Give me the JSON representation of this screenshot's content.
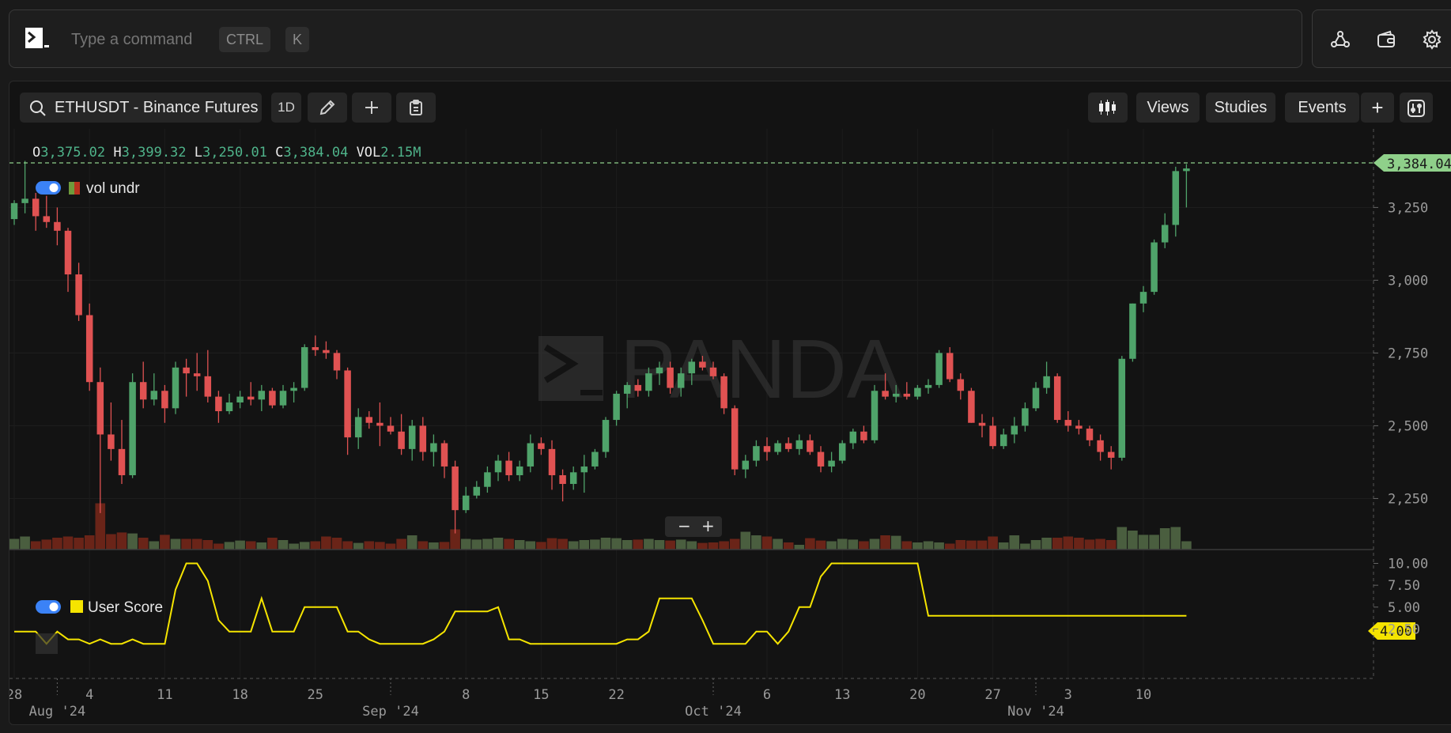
{
  "command_bar": {
    "placeholder": "Type a command",
    "key1": "CTRL",
    "key2": "K"
  },
  "toolbar": {
    "symbol": "ETHUSDT - Binance Futures",
    "interval": "1D",
    "views": "Views",
    "studies": "Studies",
    "events": "Events",
    "plus": "+"
  },
  "ohlc": {
    "o_label": "O",
    "o": "3,375.02",
    "h_label": "H",
    "h": "3,399.32",
    "l_label": "L",
    "l": "3,250.01",
    "c_label": "C",
    "c": "3,384.04",
    "vol_label": "VOL",
    "vol": "2.15M"
  },
  "legends": {
    "volume_study": "vol undr",
    "score_study": "User Score"
  },
  "watermark": "PANDA",
  "last_price_label": "3,384.04",
  "score_last_label": "4.00",
  "zoom": {
    "minus": "−",
    "plus": "+"
  },
  "colors": {
    "up": "#4fa36a",
    "down": "#e05252",
    "vol_up": "#4a5e3f",
    "vol_down": "#6a2418",
    "score": "#f5e400",
    "accent": "#3b82f6",
    "price_tag": "#8fd08a"
  },
  "chart_data": {
    "type": "candlestick",
    "price_axis": {
      "ticks": [
        "3,250",
        "3,000",
        "2,750",
        "2,500",
        "2,250"
      ],
      "range": [
        2080,
        3520
      ]
    },
    "score_axis": {
      "ticks": [
        "10.00",
        "7.50",
        "5.00",
        "2.50"
      ],
      "range": [
        0,
        10.5
      ]
    },
    "time_ticks": [
      {
        "label": "28",
        "i": 0
      },
      {
        "label": "4",
        "i": 7
      },
      {
        "label": "11",
        "i": 14
      },
      {
        "label": "18",
        "i": 21
      },
      {
        "label": "25",
        "i": 28
      },
      {
        "label": "8",
        "i": 42
      },
      {
        "label": "15",
        "i": 49
      },
      {
        "label": "22",
        "i": 56
      },
      {
        "label": "6",
        "i": 70
      },
      {
        "label": "13",
        "i": 77
      },
      {
        "label": "20",
        "i": 84
      },
      {
        "label": "27",
        "i": 91
      },
      {
        "label": "3",
        "i": 98
      },
      {
        "label": "10",
        "i": 105
      }
    ],
    "month_labels": [
      {
        "label": "Aug '24",
        "i": 4
      },
      {
        "label": "Sep '24",
        "i": 35
      },
      {
        "label": "Oct '24",
        "i": 65
      },
      {
        "label": "Nov '24",
        "i": 95
      }
    ],
    "candles": [
      [
        3210,
        3275,
        3190,
        3265
      ],
      [
        3265,
        3410,
        3230,
        3280
      ],
      [
        3280,
        3300,
        3170,
        3220
      ],
      [
        3220,
        3290,
        3180,
        3200
      ],
      [
        3200,
        3250,
        3120,
        3170
      ],
      [
        3170,
        3180,
        2960,
        3020
      ],
      [
        3020,
        3060,
        2860,
        2880
      ],
      [
        2880,
        2920,
        2620,
        2650
      ],
      [
        2650,
        2700,
        2200,
        2470
      ],
      [
        2470,
        2580,
        2380,
        2420
      ],
      [
        2420,
        2520,
        2300,
        2330
      ],
      [
        2330,
        2680,
        2320,
        2650
      ],
      [
        2650,
        2720,
        2560,
        2590
      ],
      [
        2590,
        2680,
        2570,
        2620
      ],
      [
        2620,
        2640,
        2510,
        2560
      ],
      [
        2560,
        2720,
        2540,
        2700
      ],
      [
        2700,
        2730,
        2600,
        2680
      ],
      [
        2680,
        2750,
        2620,
        2670
      ],
      [
        2670,
        2760,
        2580,
        2600
      ],
      [
        2600,
        2620,
        2510,
        2550
      ],
      [
        2550,
        2610,
        2540,
        2580
      ],
      [
        2580,
        2620,
        2560,
        2600
      ],
      [
        2600,
        2650,
        2570,
        2590
      ],
      [
        2590,
        2640,
        2550,
        2620
      ],
      [
        2620,
        2630,
        2560,
        2570
      ],
      [
        2570,
        2640,
        2560,
        2620
      ],
      [
        2620,
        2650,
        2580,
        2630
      ],
      [
        2630,
        2780,
        2620,
        2770
      ],
      [
        2770,
        2810,
        2740,
        2760
      ],
      [
        2760,
        2790,
        2730,
        2750
      ],
      [
        2750,
        2760,
        2660,
        2690
      ],
      [
        2690,
        2700,
        2400,
        2460
      ],
      [
        2460,
        2560,
        2420,
        2530
      ],
      [
        2530,
        2550,
        2490,
        2510
      ],
      [
        2510,
        2580,
        2430,
        2500
      ],
      [
        2500,
        2530,
        2470,
        2480
      ],
      [
        2480,
        2540,
        2400,
        2420
      ],
      [
        2420,
        2520,
        2380,
        2500
      ],
      [
        2500,
        2530,
        2380,
        2410
      ],
      [
        2410,
        2470,
        2360,
        2440
      ],
      [
        2440,
        2450,
        2320,
        2360
      ],
      [
        2360,
        2380,
        2130,
        2210
      ],
      [
        2210,
        2290,
        2200,
        2260
      ],
      [
        2260,
        2310,
        2250,
        2290
      ],
      [
        2290,
        2360,
        2270,
        2340
      ],
      [
        2340,
        2400,
        2310,
        2380
      ],
      [
        2380,
        2410,
        2310,
        2330
      ],
      [
        2330,
        2380,
        2310,
        2360
      ],
      [
        2360,
        2470,
        2340,
        2440
      ],
      [
        2440,
        2460,
        2400,
        2420
      ],
      [
        2420,
        2450,
        2280,
        2330
      ],
      [
        2330,
        2350,
        2240,
        2300
      ],
      [
        2300,
        2360,
        2280,
        2340
      ],
      [
        2340,
        2400,
        2270,
        2360
      ],
      [
        2360,
        2420,
        2350,
        2410
      ],
      [
        2410,
        2530,
        2390,
        2520
      ],
      [
        2520,
        2620,
        2500,
        2610
      ],
      [
        2610,
        2650,
        2560,
        2640
      ],
      [
        2640,
        2660,
        2600,
        2620
      ],
      [
        2620,
        2700,
        2600,
        2680
      ],
      [
        2680,
        2720,
        2640,
        2700
      ],
      [
        2700,
        2720,
        2610,
        2630
      ],
      [
        2630,
        2700,
        2600,
        2680
      ],
      [
        2680,
        2730,
        2640,
        2720
      ],
      [
        2720,
        2740,
        2690,
        2700
      ],
      [
        2700,
        2720,
        2660,
        2670
      ],
      [
        2670,
        2680,
        2540,
        2560
      ],
      [
        2560,
        2570,
        2330,
        2350
      ],
      [
        2350,
        2400,
        2320,
        2380
      ],
      [
        2380,
        2450,
        2360,
        2430
      ],
      [
        2430,
        2460,
        2380,
        2410
      ],
      [
        2410,
        2450,
        2400,
        2440
      ],
      [
        2440,
        2460,
        2410,
        2420
      ],
      [
        2420,
        2470,
        2400,
        2450
      ],
      [
        2450,
        2470,
        2400,
        2410
      ],
      [
        2410,
        2430,
        2340,
        2360
      ],
      [
        2360,
        2410,
        2340,
        2380
      ],
      [
        2380,
        2450,
        2370,
        2440
      ],
      [
        2440,
        2490,
        2420,
        2480
      ],
      [
        2480,
        2500,
        2440,
        2450
      ],
      [
        2450,
        2640,
        2440,
        2620
      ],
      [
        2620,
        2680,
        2590,
        2600
      ],
      [
        2600,
        2640,
        2580,
        2610
      ],
      [
        2610,
        2650,
        2590,
        2600
      ],
      [
        2600,
        2640,
        2590,
        2630
      ],
      [
        2630,
        2660,
        2610,
        2640
      ],
      [
        2640,
        2760,
        2630,
        2750
      ],
      [
        2750,
        2770,
        2650,
        2660
      ],
      [
        2660,
        2680,
        2590,
        2620
      ],
      [
        2620,
        2630,
        2510,
        2510
      ],
      [
        2510,
        2540,
        2460,
        2500
      ],
      [
        2500,
        2530,
        2420,
        2430
      ],
      [
        2430,
        2490,
        2420,
        2470
      ],
      [
        2470,
        2530,
        2440,
        2500
      ],
      [
        2500,
        2580,
        2480,
        2560
      ],
      [
        2560,
        2650,
        2550,
        2630
      ],
      [
        2630,
        2720,
        2610,
        2670
      ],
      [
        2670,
        2680,
        2510,
        2520
      ],
      [
        2520,
        2550,
        2480,
        2500
      ],
      [
        2500,
        2520,
        2470,
        2490
      ],
      [
        2490,
        2500,
        2430,
        2450
      ],
      [
        2450,
        2470,
        2380,
        2410
      ],
      [
        2410,
        2430,
        2350,
        2390
      ],
      [
        2390,
        2740,
        2380,
        2730
      ],
      [
        2730,
        2920,
        2720,
        2920
      ],
      [
        2920,
        2980,
        2890,
        2960
      ],
      [
        2960,
        3140,
        2950,
        3130
      ],
      [
        3130,
        3230,
        3110,
        3190
      ],
      [
        3190,
        3390,
        3150,
        3375
      ],
      [
        3375,
        3399,
        3250,
        3384
      ]
    ],
    "volume_rel": [
      0.45,
      0.55,
      0.35,
      0.42,
      0.5,
      0.55,
      0.5,
      0.6,
      1.95,
      0.65,
      0.72,
      0.68,
      0.5,
      0.35,
      0.62,
      0.45,
      0.45,
      0.45,
      0.4,
      0.25,
      0.32,
      0.38,
      0.35,
      0.3,
      0.5,
      0.4,
      0.25,
      0.32,
      0.35,
      0.55,
      0.5,
      0.35,
      0.28,
      0.35,
      0.32,
      0.25,
      0.45,
      0.6,
      0.35,
      0.3,
      0.32,
      0.85,
      0.45,
      0.42,
      0.45,
      0.5,
      0.45,
      0.4,
      0.35,
      0.32,
      0.48,
      0.45,
      0.35,
      0.4,
      0.42,
      0.5,
      0.48,
      0.4,
      0.42,
      0.45,
      0.4,
      0.38,
      0.42,
      0.35,
      0.28,
      0.3,
      0.35,
      0.45,
      0.75,
      0.6,
      0.55,
      0.45,
      0.3,
      0.2,
      0.48,
      0.38,
      0.35,
      0.45,
      0.42,
      0.35,
      0.45,
      0.6,
      0.58,
      0.35,
      0.3,
      0.35,
      0.3,
      0.25,
      0.4,
      0.38,
      0.38,
      0.55,
      0.3,
      0.6,
      0.25,
      0.4,
      0.5,
      0.5,
      0.55,
      0.5,
      0.42,
      0.45,
      0.4,
      0.95,
      0.8,
      0.62,
      0.62,
      0.9,
      0.95,
      0.35
    ],
    "score": [
      2.2,
      2.2,
      2.2,
      0.8,
      2.2,
      1.3,
      1.3,
      0.8,
      1.3,
      0.8,
      0.8,
      1.3,
      0.8,
      0.8,
      0.8,
      7.0,
      10.0,
      10.0,
      8.0,
      3.5,
      2.2,
      2.2,
      2.2,
      6.0,
      2.2,
      2.2,
      2.2,
      5.0,
      5.0,
      5.0,
      5.0,
      2.2,
      2.2,
      1.3,
      0.8,
      0.8,
      0.8,
      0.8,
      0.8,
      1.3,
      2.2,
      4.5,
      4.5,
      4.5,
      4.5,
      5.0,
      1.3,
      1.3,
      0.8,
      0.8,
      0.8,
      0.8,
      0.8,
      0.8,
      0.8,
      0.8,
      0.8,
      1.3,
      1.3,
      2.2,
      6.0,
      6.0,
      6.0,
      6.0,
      3.5,
      0.8,
      0.8,
      0.8,
      0.8,
      2.2,
      2.2,
      0.8,
      2.2,
      5.0,
      5.0,
      8.5,
      10.0,
      10.0,
      10.0,
      10.0,
      10.0,
      10.0,
      10.0,
      10.0,
      10.0,
      4.0,
      4.0,
      4.0,
      4.0,
      4.0,
      4.0,
      4.0,
      4.0,
      4.0,
      4.0,
      4.0,
      4.0,
      4.0,
      4.0,
      4.0,
      4.0,
      4.0,
      4.0,
      4.0,
      4.0,
      4.0,
      4.0,
      4.0,
      4.0,
      4.0
    ]
  }
}
